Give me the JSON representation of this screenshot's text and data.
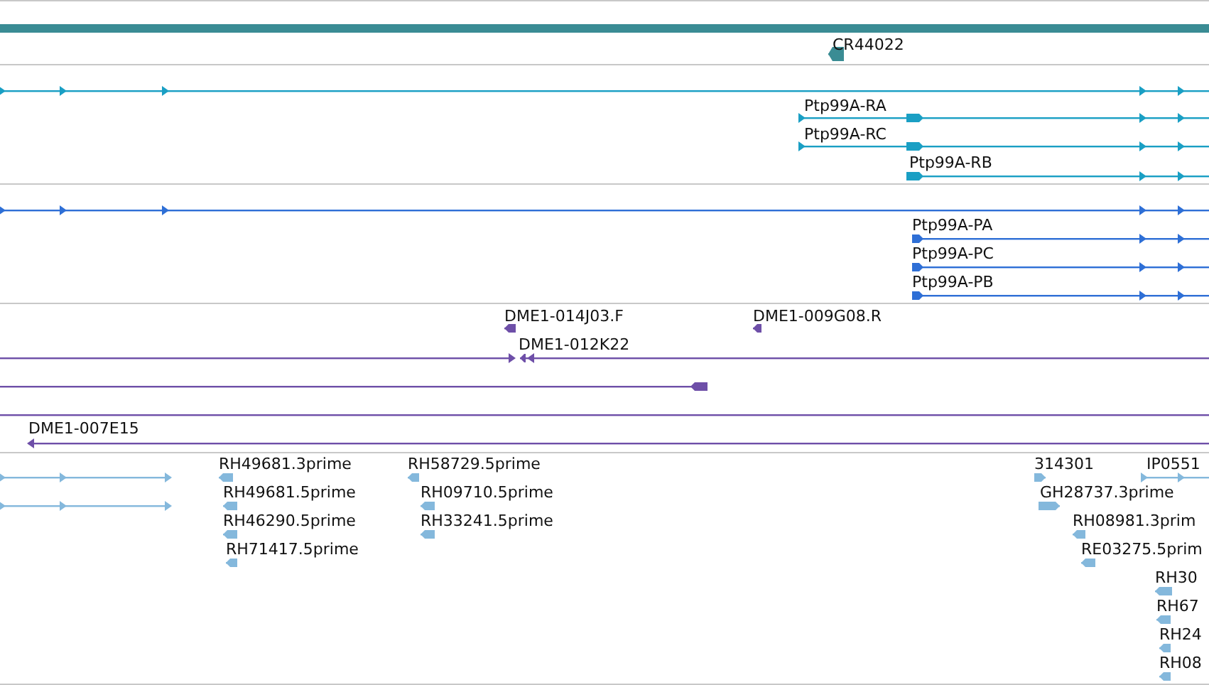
{
  "tracks": [
    {
      "color": "#3a8c94",
      "features": [
        {
          "kind": "bar"
        },
        {
          "kind": "model",
          "reverse": true,
          "label": "CR44022"
        }
      ]
    },
    {
      "color": "#1a9fc4",
      "features": [
        {
          "kind": "model",
          "reverse": false
        },
        {
          "kind": "model",
          "reverse": false,
          "label": "Ptp99A-RA"
        },
        {
          "kind": "model",
          "reverse": false,
          "label": "Ptp99A-RC"
        },
        {
          "kind": "model",
          "reverse": false,
          "label": "Ptp99A-RB"
        }
      ]
    },
    {
      "color": "#2e6fd6",
      "features": [
        {
          "kind": "model",
          "reverse": false
        },
        {
          "kind": "model",
          "reverse": false,
          "label": "Ptp99A-PA"
        },
        {
          "kind": "model",
          "reverse": false,
          "label": "Ptp99A-PC"
        },
        {
          "kind": "model",
          "reverse": false,
          "label": "Ptp99A-PB"
        }
      ]
    },
    {
      "color": "#6e4fa8",
      "features": [
        {
          "kind": "model",
          "reverse": true,
          "label": "DME1-014J03.F"
        },
        {
          "kind": "model",
          "reverse": true,
          "label": "DME1-009G08.R"
        },
        {
          "kind": "model",
          "reverse": true,
          "label": "DME1-012K22"
        },
        {
          "kind": "model",
          "reverse": false
        },
        {
          "kind": "model",
          "reverse": true
        },
        {
          "kind": "model",
          "reverse": false
        },
        {
          "kind": "model",
          "reverse": true,
          "label": "DME1-007E15"
        }
      ]
    },
    {
      "color": "#84b8dc",
      "features": [
        {
          "kind": "model",
          "reverse": false
        },
        {
          "kind": "model",
          "reverse": false
        },
        {
          "kind": "model",
          "reverse": true,
          "label": "RH49681.3prime"
        },
        {
          "kind": "model",
          "reverse": true,
          "label": "RH49681.5prime"
        },
        {
          "kind": "model",
          "reverse": true,
          "label": "RH46290.5prime"
        },
        {
          "kind": "model",
          "reverse": true,
          "label": "RH71417.5prime"
        },
        {
          "kind": "model",
          "reverse": true,
          "label": "RH58729.5prime"
        },
        {
          "kind": "model",
          "reverse": true,
          "label": "RH09710.5prime"
        },
        {
          "kind": "model",
          "reverse": true,
          "label": "RH33241.5prime"
        },
        {
          "kind": "model",
          "reverse": false,
          "label": "314301"
        },
        {
          "kind": "model",
          "reverse": false,
          "label": "IP0551"
        },
        {
          "kind": "model",
          "reverse": false,
          "label": "GH28737.3prime"
        },
        {
          "kind": "model",
          "reverse": true,
          "label": "RH08981.3prim"
        },
        {
          "kind": "model",
          "reverse": true,
          "label": "RE03275.5prim"
        },
        {
          "kind": "model",
          "reverse": true,
          "label": "RH30"
        },
        {
          "kind": "model",
          "reverse": true,
          "label": "RH67"
        },
        {
          "kind": "model",
          "reverse": true,
          "label": "RH24"
        },
        {
          "kind": "model",
          "reverse": true,
          "label": "RH08"
        }
      ]
    }
  ]
}
